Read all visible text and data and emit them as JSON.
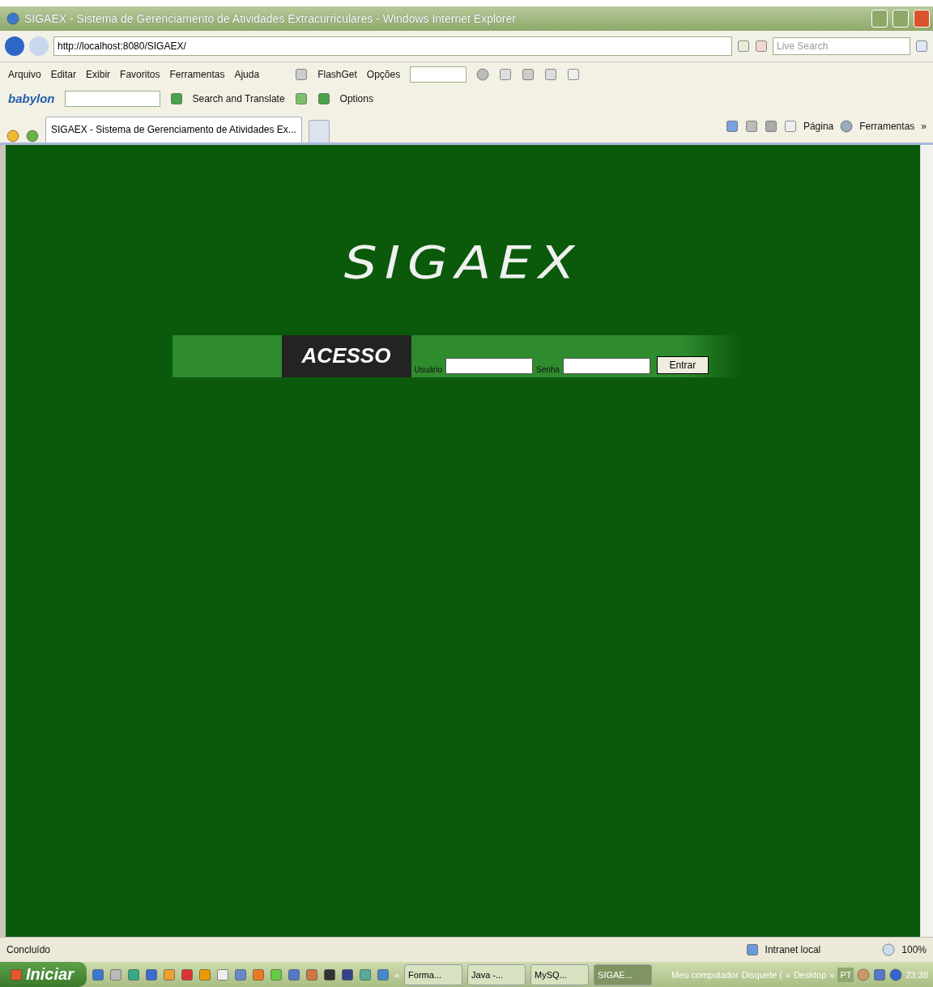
{
  "window": {
    "title": "SIGAEX - Sistema de Gerenciamento de Atividades Extracurriculares - Windows Internet Explorer"
  },
  "address_bar": {
    "url": "http://localhost:8080/SIGAEX/",
    "search_placeholder": "Live Search"
  },
  "menu": [
    "Arquivo",
    "Editar",
    "Exibir",
    "Favoritos",
    "Ferramentas",
    "Ajuda"
  ],
  "flashget_toolbar": {
    "label": "FlashGet",
    "options": "Opções"
  },
  "babylon_toolbar": {
    "logo": "babylon",
    "search": "Search and Translate",
    "options": "Options"
  },
  "tabs": [
    {
      "label": "SIGAEX - Sistema de Gerenciamento de Atividades Ex...",
      "selected": true
    }
  ],
  "command_bar": {
    "page": "Página",
    "tools": "Ferramentas",
    "more": "»"
  },
  "page": {
    "logo": "SIGAEX",
    "heading": "ACESSO",
    "user_label": "Usuário",
    "password_label": "Senha",
    "submit": "Entrar"
  },
  "status_bar": {
    "text": "Concluído",
    "zone": "Intranet local",
    "zoom": "100%"
  },
  "taskbar": {
    "start": "Iniciar",
    "more": "»",
    "tasks": [
      {
        "label": "Forma...",
        "selected": false
      },
      {
        "label": "Java -...",
        "selected": false
      },
      {
        "label": "MySQ...",
        "selected": false
      },
      {
        "label": "SIGAE...",
        "selected": true
      }
    ],
    "tray": [
      "Meu computador",
      "Disquete (",
      "»",
      "Desktop",
      "»"
    ],
    "language": "PT",
    "clock": "23:38"
  }
}
